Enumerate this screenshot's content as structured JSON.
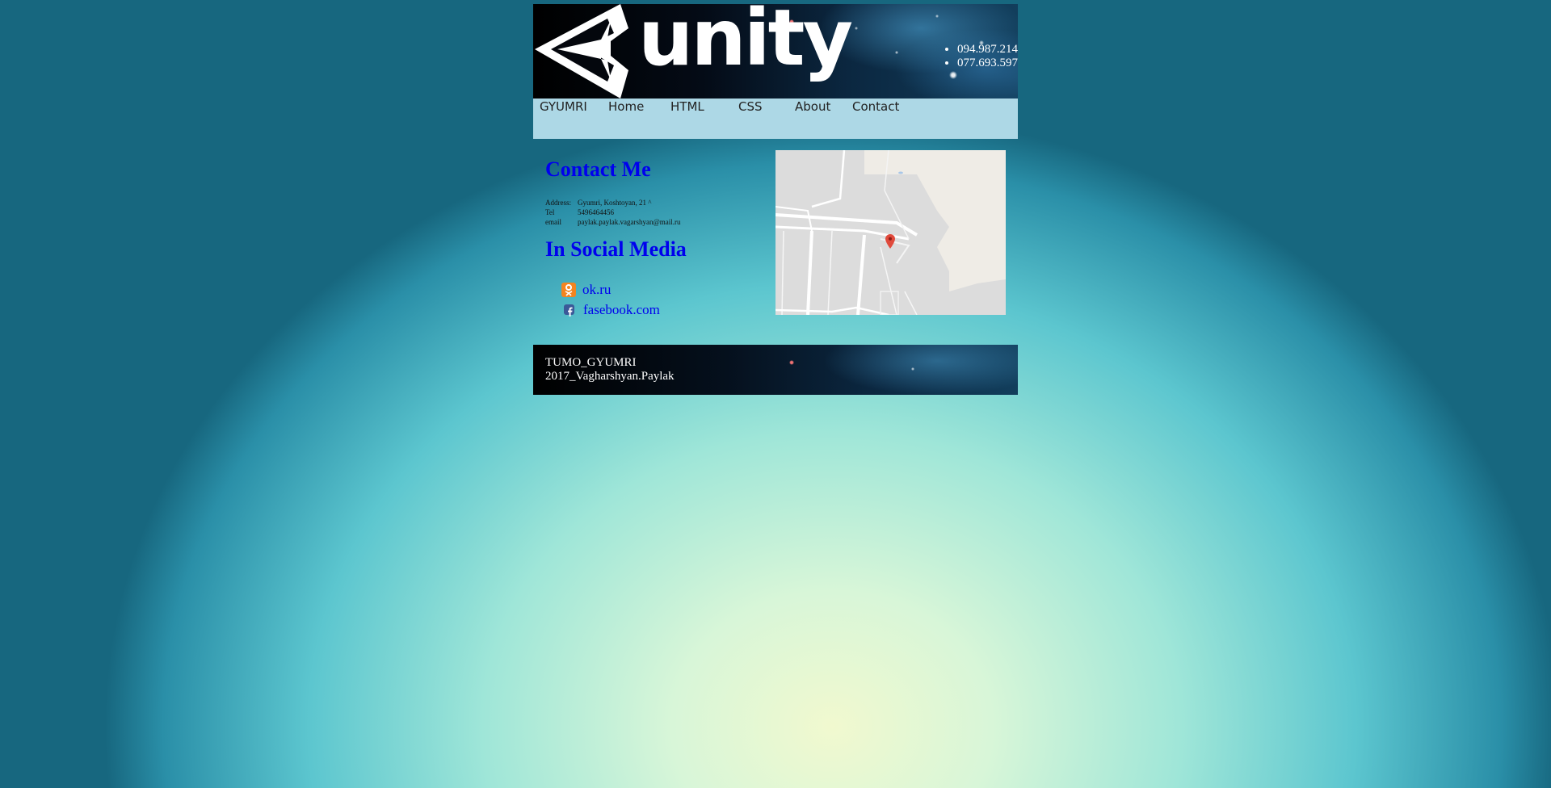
{
  "header": {
    "logo_text": "unity",
    "phones": [
      "094.987.214",
      "077.693.597"
    ]
  },
  "nav": {
    "items": [
      "GYUMRI",
      "Home",
      "HTML",
      "CSS",
      "About",
      "Contact"
    ]
  },
  "contact": {
    "title": "Contact Me",
    "rows": [
      {
        "label": "Address:",
        "value": "Gyumri, Koshtoyan, 21 ^"
      },
      {
        "label": "Tel",
        "value": "5496464456"
      },
      {
        "label": "email",
        "value": "paylak.paylak.vagarshyan@mail.ru"
      }
    ]
  },
  "social": {
    "title": "In Social Media",
    "links": [
      {
        "label": "ok.ru",
        "icon": "ok-icon"
      },
      {
        "label": "fasebook.com",
        "icon": "facebook-icon"
      }
    ]
  },
  "map": {
    "marker_icon": "map-marker-icon"
  },
  "footer": {
    "line1": "TUMO_GYUMRI",
    "line2": "2017_Vagharshyan.Paylak"
  }
}
